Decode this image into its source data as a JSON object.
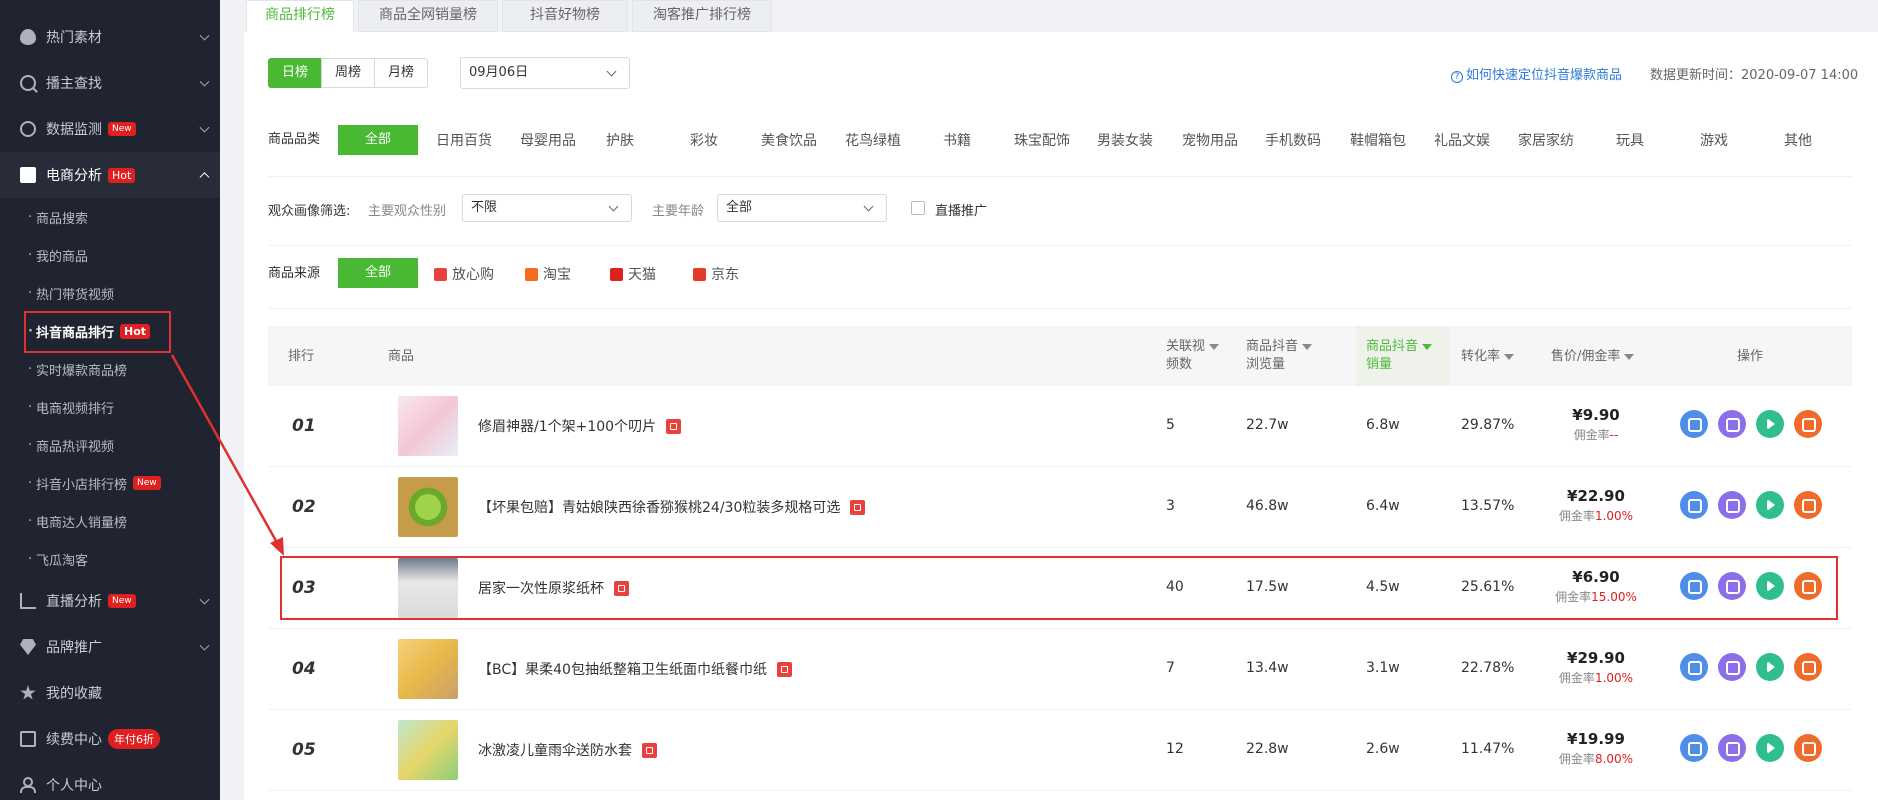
{
  "sidebar": {
    "groups": [
      {
        "label": "热门素材",
        "icon": "flame-icon"
      },
      {
        "label": "播主查找",
        "icon": "search-icon"
      },
      {
        "label": "数据监测",
        "icon": "gauge-icon",
        "badge": "New"
      },
      {
        "label": "电商分析",
        "icon": "bag-icon",
        "badge": "Hot"
      },
      {
        "label": "直播分析",
        "icon": "chart-icon",
        "badge": "New"
      },
      {
        "label": "品牌推广",
        "icon": "diamond-icon"
      },
      {
        "label": "我的收藏",
        "icon": "star-icon"
      },
      {
        "label": "续费中心",
        "icon": "card-icon",
        "badge": "年付6折"
      },
      {
        "label": "个人中心",
        "icon": "user-icon"
      }
    ],
    "subitems": [
      {
        "label": "商品搜索"
      },
      {
        "label": "我的商品"
      },
      {
        "label": "热门带货视频"
      },
      {
        "label": "抖音商品排行",
        "badge": "Hot"
      },
      {
        "label": "实时爆款商品榜"
      },
      {
        "label": "电商视频排行"
      },
      {
        "label": "商品热评视频"
      },
      {
        "label": "抖音小店排行榜",
        "badge": "New"
      },
      {
        "label": "电商达人销量榜"
      },
      {
        "label": "飞瓜淘客"
      }
    ]
  },
  "tabs": [
    "商品排行榜",
    "商品全网销量榜",
    "抖音好物榜",
    "淘客推广排行榜"
  ],
  "period": {
    "options": [
      "日榜",
      "周榜",
      "月榜"
    ],
    "date": "09月06日"
  },
  "help_link": "如何快速定位抖音爆款商品",
  "update_time": "数据更新时间：2020-09-07 14:00",
  "category": {
    "label": "商品品类",
    "items": [
      "全部",
      "日用百货",
      "母婴用品",
      "护肤",
      "彩妆",
      "美食饮品",
      "花鸟绿植",
      "书籍",
      "珠宝配饰",
      "男装女装",
      "宠物用品",
      "手机数码",
      "鞋帽箱包",
      "礼品文娱",
      "家居家纺",
      "玩具",
      "游戏",
      "其他"
    ]
  },
  "audience": {
    "label": "观众画像筛选:",
    "gender_label": "主要观众性别",
    "gender_value": "不限",
    "age_label": "主要年龄",
    "age_value": "全部",
    "live_label": "直播推广"
  },
  "source": {
    "label": "商品来源",
    "items": [
      {
        "label": "全部"
      },
      {
        "label": "放心购",
        "color": "#e8413e"
      },
      {
        "label": "淘宝",
        "color": "#f56a1c"
      },
      {
        "label": "天猫",
        "color": "#d9231c"
      },
      {
        "label": "京东",
        "color": "#e33a2a"
      }
    ]
  },
  "table": {
    "headers": {
      "rank": "排行",
      "product": "商品",
      "videos_1": "关联视",
      "videos_2": "频数",
      "views_1": "商品抖音",
      "views_2": "浏览量",
      "sales_1": "商品抖音",
      "sales_2": "销量",
      "conversion": "转化率",
      "price": "售价/佣金率",
      "ops": "操作"
    },
    "commission_label": "佣金率",
    "rows": [
      {
        "rank": "01",
        "name": "修眉神器/1个架+100个叨片",
        "videos": "5",
        "views": "22.7w",
        "sales": "6.8w",
        "conversion": "29.87%",
        "price": "¥9.90",
        "commission": "--"
      },
      {
        "rank": "02",
        "name": "【坏果包赔】青姑娘陕西徐香猕猴桃24/30粒装多规格可选",
        "videos": "3",
        "views": "46.8w",
        "sales": "6.4w",
        "conversion": "13.57%",
        "price": "¥22.90",
        "commission": "1.00%"
      },
      {
        "rank": "03",
        "name": "居家一次性原浆纸杯",
        "videos": "40",
        "views": "17.5w",
        "sales": "4.5w",
        "conversion": "25.61%",
        "price": "¥6.90",
        "commission": "15.00%"
      },
      {
        "rank": "04",
        "name": "【BC】果柔40包抽纸整箱卫生纸面巾纸餐巾纸",
        "videos": "7",
        "views": "13.4w",
        "sales": "3.1w",
        "conversion": "22.78%",
        "price": "¥29.90",
        "commission": "1.00%"
      },
      {
        "rank": "05",
        "name": "冰激凌儿童雨伞送防水套",
        "videos": "12",
        "views": "22.8w",
        "sales": "2.6w",
        "conversion": "11.47%",
        "price": "¥19.99",
        "commission": "8.00%"
      }
    ]
  },
  "colors": {
    "accent": "#49b933",
    "sidebar_bg": "#1f2430",
    "highlight": "#e03030",
    "link": "#2f7ad8"
  }
}
